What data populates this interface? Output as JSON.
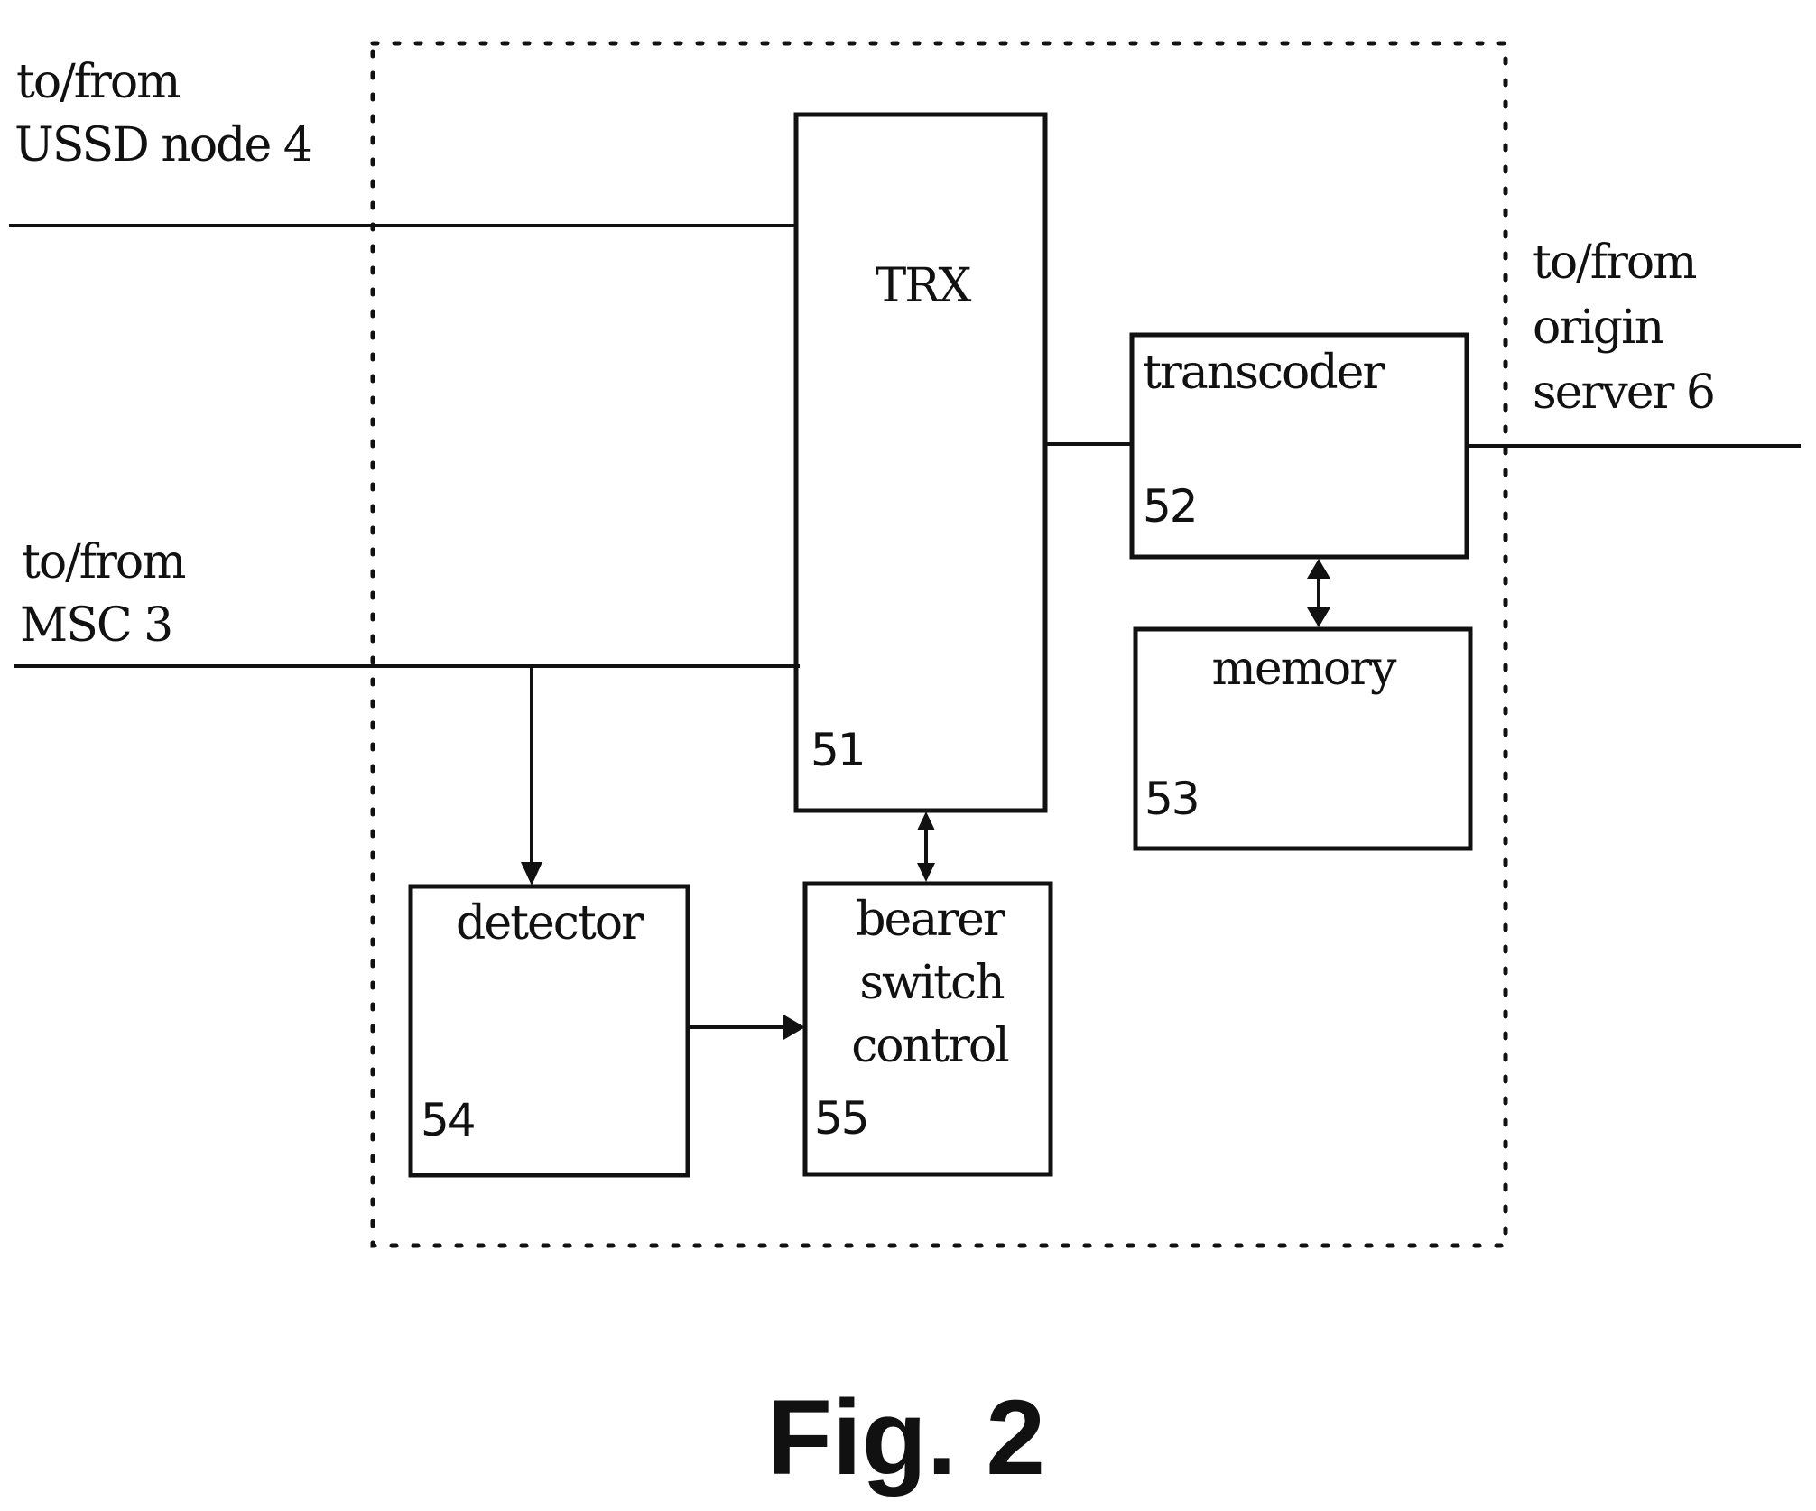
{
  "figure": {
    "caption": "Fig. 2",
    "external_labels": {
      "ussd": [
        "to/from",
        "USSD node 4"
      ],
      "msc": [
        "to/from",
        "MSC 3"
      ],
      "origin": [
        "to/from",
        "origin",
        "server 6"
      ]
    },
    "blocks": {
      "trx": {
        "name": "TRX",
        "ref": "51"
      },
      "transcoder": {
        "name": "transcoder",
        "ref": "52"
      },
      "memory": {
        "name": "memory",
        "ref": "53"
      },
      "detector": {
        "name": "detector",
        "ref": "54"
      },
      "bearer": {
        "name_lines": [
          "bearer",
          "switch",
          "control"
        ],
        "ref": "55"
      }
    },
    "connections": [
      {
        "from": "USSD node 4",
        "to": "TRX",
        "type": "line"
      },
      {
        "from": "MSC 3",
        "to": "TRX",
        "type": "line"
      },
      {
        "from": "MSC 3 line",
        "to": "detector",
        "type": "arrow"
      },
      {
        "from": "TRX",
        "to": "bearer switch control",
        "type": "bidirectional-arrow"
      },
      {
        "from": "detector",
        "to": "bearer switch control",
        "type": "arrow"
      },
      {
        "from": "TRX",
        "to": "transcoder",
        "type": "line"
      },
      {
        "from": "transcoder",
        "to": "memory",
        "type": "bidirectional-arrow"
      },
      {
        "from": "transcoder",
        "to": "origin server 6",
        "type": "line"
      }
    ]
  }
}
